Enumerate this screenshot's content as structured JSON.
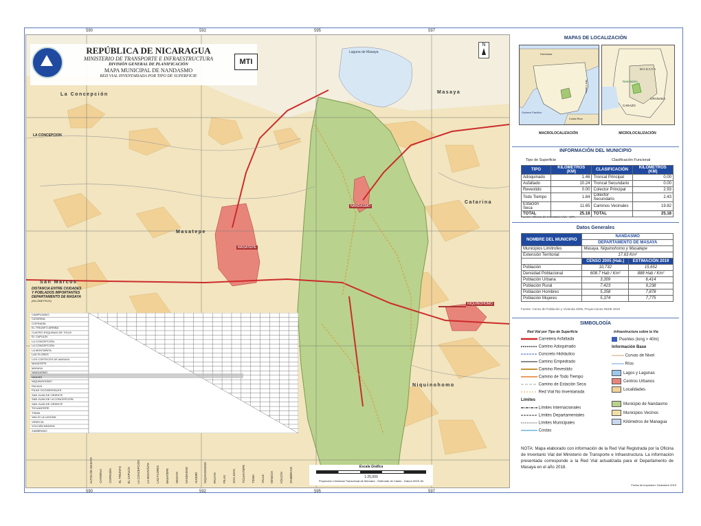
{
  "header": {
    "country": "REPÚBLICA DE NICARAGUA",
    "ministry": "MINISTERIO DE TRANSPORTE E INFRAESTRUCTURA",
    "division": "DIVISIÓN GENERAL DE PLANIFICACIÓN",
    "map_title": "MAPA MUNICIPAL DE NANDASMO",
    "subtitle": "RED VIAL INVENTARIADA POR TIPO DE SUPERFICIE",
    "logo_text": "MTI"
  },
  "grid_ticks": {
    "top": [
      "590",
      "592",
      "595",
      "597"
    ],
    "bottom": [
      "590",
      "592",
      "595",
      "597"
    ],
    "left": [
      "1320",
      "1318",
      "1316"
    ],
    "right": [
      "1320",
      "1318",
      "1316"
    ]
  },
  "map_labels": {
    "la_concepcion": "La Concepción",
    "masaya": "Masaya",
    "masatepe": "Masatepe",
    "nandasmo": "NANDASMO",
    "nandasmo_box": "NANDASMO",
    "masatepe_box": "MASATEPE",
    "la_concepcion_box": "LA CONCEPCION",
    "niquinohomo": "Niquinohomo",
    "niquinohomo_box": "NIQUINOHOMO",
    "san_marcos": "San Marcos",
    "catarina": "Catarina",
    "laguna": "Laguna de Masaya",
    "north": "N",
    "towns": [
      "La Cebita",
      "Camino de Jesús",
      "Las Flores",
      "Los Ángeles",
      "El Arenal",
      "Pio XII",
      "Valle Gothel",
      "El Tempisque",
      "El Rosario",
      "Las Pilas",
      "El Ojoche",
      "Santa Rosa",
      "San Jerónimo",
      "El Coyol",
      "Totogalpa",
      "Los Pozos",
      "Sabana Grande",
      "El Portillo",
      "El Jícaro",
      "Hoja Chigüe",
      "Monte Fresco",
      "Guanacaste",
      "San Isidro",
      "El Guapinol",
      "Los Lirios",
      "El Guayabo",
      "Tanque",
      "El Pochote"
    ]
  },
  "distance_table": {
    "title_lines": [
      "DISTANCIA ENTRE CIUDADES",
      "Y POBLADOS IMPORTANTES",
      "DEPARTAMENTO DE MASAYA",
      "(KILÓMETROS)"
    ],
    "rows": [
      "CAMPUZANO",
      "CATARINA",
      "COFRADÍA",
      "EL TRIUNFO ARRIBA",
      "CUATRO ESQUINAS DE TICUS",
      "EL CAPULÍN",
      "LA CONCEPCIÓN",
      "LA CONCEPCIÓN",
      "LA MONTAÑITA",
      "LAS FLORES",
      "LOS CORTECES DE MASAYA",
      "MASATEPE",
      "MASAYA",
      "NANDASMO",
      "NINDIRÍ",
      "NIQUINOHOMO",
      "PACAYA",
      "PILAS OCCIDENTALES",
      "SAN JUAN DE ORIENTE",
      "SAN JUAN DE LA CONCEPCIÓN",
      "SAN JUAN DE ORIENTE",
      "TICUANTEPE",
      "TISMA",
      "VALLE LA LAGUNA",
      "VENECIA",
      "VOLCÁN MASAYA",
      "ZAMBRANO"
    ],
    "columns": [
      "ALTOS DE MASAYA",
      "CATARINA",
      "COFRADÍA",
      "EL TRIUNFO",
      "EL CAPULÍN",
      "LA CONCEPCIÓN",
      "LA MONTAÑITA",
      "LAS FLORES",
      "MASATEPE",
      "MASAYA",
      "NANDASMO",
      "NINDIRÍ",
      "NIQUINOHOMO",
      "PACAYA",
      "PILAS",
      "SAN JUAN",
      "TICUANTEPE",
      "TISMA",
      "VALLE",
      "VENECIA",
      "VOLCÁN",
      "ZAMBRANO"
    ]
  },
  "scale": {
    "title": "Escala Gráfica",
    "ratio": "1:25,000",
    "projection": "Proyección Universal Transversal de Mercator - Esferoide de Clarke - Datum WGS 84"
  },
  "right_panel": {
    "location_title": "MAPAS DE LOCALIZACIÓN",
    "macro": "MACROLOCALIZACIÓN",
    "micro": "MICROLOCALIZACIÓN",
    "macro_labels": [
      "Honduras",
      "Costa Rica",
      "Océano Pacífico",
      "Mar Caribe"
    ],
    "micro_labels": [
      "MASAYA",
      "Nandasmo",
      "GRANADA",
      "CARAZO"
    ],
    "info_title": "INFORMACIÓN DEL MUNICIPIO",
    "surface_type_title": "Tipo de Superficie",
    "functional_title": "Clasificación Funcional",
    "col_tipo": "TIPO",
    "col_km": "KILÓMETROS (KM)",
    "col_clas": "CLASIFICACIÓN",
    "surface_rows": [
      {
        "tipo": "Adoquinado",
        "km": "1.46",
        "clas": "Troncal Principal",
        "ckm": "0.00"
      },
      {
        "tipo": "Asfaltado",
        "km": "10.24",
        "clas": "Troncal Secundario",
        "ckm": "0.00"
      },
      {
        "tipo": "Revestido",
        "km": "0.00",
        "clas": "Colector Principal",
        "ckm": "2.93"
      },
      {
        "tipo": "Todo Tiempo",
        "km": "1.84",
        "clas": "Colector Secundario",
        "ckm": "2.43"
      },
      {
        "tipo": "Estación Seca",
        "km": "11.65",
        "clas": "Caminos Vecinales",
        "ckm": "19.82"
      }
    ],
    "total_label": "TOTAL",
    "total_km": "25.18",
    "total_ckm": "25.18",
    "source1": "Fuente: Oficina de Inventario Vial - MTI.",
    "general_title": "Datos Generales",
    "muni_name_label": "NOMBRE DEL MUNICIPIO",
    "muni_name": "NANDASMO",
    "dept_label": "DEPARTAMENTO DE MASAYA",
    "limits_label": "Municipios Limítrofes",
    "limits_value": "Masaya, Niquinohomo y Masatepe",
    "extension_label": "Extensión Territorial",
    "extension_value": "17.63  Km²",
    "census_label": "CENSO 2005 (Hab.)",
    "estimate_label": "ESTIMACIÓN 2019",
    "general_rows": [
      {
        "label": "Población",
        "c": "10,732",
        "e": "15,652"
      },
      {
        "label": "Densidad Poblacional",
        "c": "608.7 Hab / Km²",
        "e": "888 Hab / Km²"
      },
      {
        "label": "Población Urbana",
        "c": "3,309",
        "e": "6,414"
      },
      {
        "label": "Población Rural",
        "c": "7,423",
        "e": "9,238"
      },
      {
        "label": "Población Hombres",
        "c": "5,358",
        "e": "7,878"
      },
      {
        "label": "Población Mujeres",
        "c": "5,374",
        "e": "7,775"
      }
    ],
    "source2": "Fuente: Censo de Población y Vivienda 2005, Proyecciones INIDE 2019",
    "symbology_title": "SIMBOLOGÍA",
    "legend_left_title": "Red Vial por Tipo de Superficie",
    "legend_right_title": "Infraestructura sobre la Vía",
    "legend_left": [
      "Carretera Asfaltada",
      "Camino Adoquinado",
      "Concreto Hidráulico",
      "Camino Empedrado",
      "Camino Revestido",
      "Camino de Todo Tiempo",
      "Camino de Estación Seca",
      "Red Vial No Inventariada"
    ],
    "legend_right": [
      "Puentes (long > 40m)",
      "Información Base",
      "Curvas de Nivel",
      "Ríos",
      "Lagos y Lagunas",
      "Centros Urbanos",
      "Localidades"
    ],
    "limits_title": "Límites",
    "limits_items": [
      "Límites Internacionales",
      "Límites Departamentales",
      "Límites Municipales",
      "Costas"
    ],
    "limits_right": [
      "Municipio de Nandasmo",
      "Municipios Vecinos",
      "Kilómetros de Managua"
    ],
    "note": "NOTA: Mapa elaborado con información de la Red Vial Registrada por la Oficina de Inventario Vial del Ministerio de Transporte e Infraestructura. La información presentada corresponde a la Red Vial actualizada para el Departamento de Masaya en el año 2018.",
    "print_date": "Fecha de Impresión: Diciembre 2019"
  },
  "colors": {
    "frame": "#5a7ab8",
    "base": "#f3eede",
    "muni": "#b9d28d",
    "urban": "#e8857a",
    "neighbors": "#f1dfa6",
    "road_asphalt": "#cc2b2b",
    "header_blue": "#1f4aa0"
  }
}
